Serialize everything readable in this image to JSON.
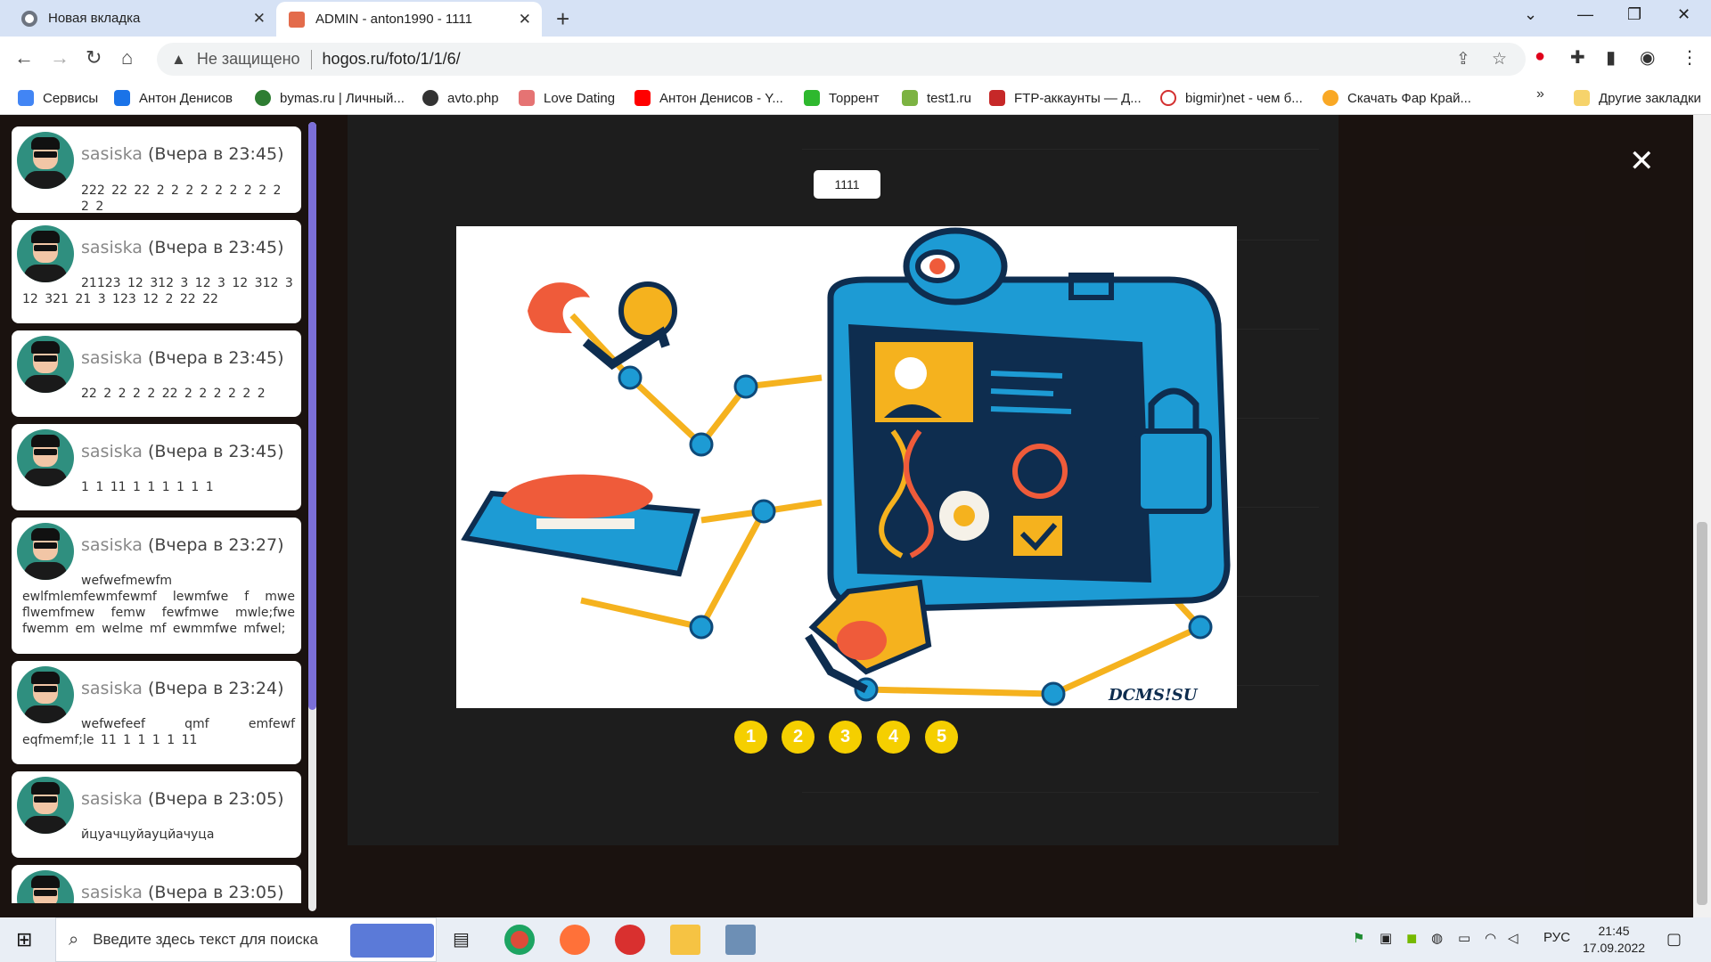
{
  "browser": {
    "tabs": [
      {
        "title": "Новая вкладка"
      },
      {
        "title": "ADMIN - anton1990 - 1111"
      }
    ],
    "address": {
      "security": "Не защищено",
      "url": "hogos.ru/foto/1/1/6/"
    },
    "bookmarks": [
      {
        "label": "Сервисы",
        "color": "#4285f4"
      },
      {
        "label": "Антон Денисов",
        "color": "#1a73e8"
      },
      {
        "label": "bymas.ru | Личный...",
        "color": "#2e7d32"
      },
      {
        "label": "avto.php",
        "color": "#333333"
      },
      {
        "label": "Love Dating",
        "color": "#e57373"
      },
      {
        "label": "Антон Денисов - Y...",
        "color": "#ff0000"
      },
      {
        "label": "Торрент",
        "color": "#2eb82e"
      },
      {
        "label": "test1.ru",
        "color": "#7cb342"
      },
      {
        "label": "FTP-аккаунты — Д...",
        "color": "#c62828"
      },
      {
        "label": "bigmir)net - чем б...",
        "color": "#d32f2f"
      },
      {
        "label": "Скачать Фар Край...",
        "color": "#f9a825"
      }
    ],
    "bookmarks_more": "»",
    "other_bookmarks": "Другие закладки"
  },
  "chat": {
    "messages": [
      {
        "user": "sasiska",
        "time": "(Вчера в 23:45)",
        "text": "222 22 22 2 2 2 2 2 2 2 2 2 2 2"
      },
      {
        "user": "sasiska",
        "time": "(Вчера в 23:45)",
        "text": "21123 12 312 3 12 3 12 312 3 12 321 21 3 123 12 2 22 22"
      },
      {
        "user": "sasiska",
        "time": "(Вчера в 23:45)",
        "text": "22 2 2 2 2 22 2 2 2 2 2 2"
      },
      {
        "user": "sasiska",
        "time": "(Вчера в 23:45)",
        "text": "1 1 11 1 1 1 1 1 1"
      },
      {
        "user": "sasiska",
        "time": "(Вчера в 23:27)",
        "text": "wefwefmewfm ewlfmlemfewmfewmf lewmfwe f mwe flwemfmew femw fewfmwe mwle;fwe fwemm em welme mf ewmmfwe mfwel;"
      },
      {
        "user": "sasiska",
        "time": "(Вчера в 23:24)",
        "text": "wefwefeef qmf emfewf eqfmemf;le 11 1 1 1 1 11"
      },
      {
        "user": "sasiska",
        "time": "(Вчера в 23:05)",
        "text": "йцуачцуйауцйачуца"
      },
      {
        "user": "sasiska",
        "time": "(Вчера в 23:05)",
        "text": ""
      }
    ]
  },
  "lightbox": {
    "title": "1111",
    "close": "✕",
    "watermark": "DCMS!SU",
    "pages": [
      "1",
      "2",
      "3",
      "4",
      "5"
    ]
  },
  "taskbar": {
    "search_placeholder": "Введите здесь текст для поиска",
    "language": "РУС",
    "time": "21:45",
    "date": "17.09.2022"
  },
  "colors": {
    "pager": "#f5cf00",
    "scroll_thumb": "#7b6fd8",
    "tab_strip": "#d6e2f5"
  }
}
